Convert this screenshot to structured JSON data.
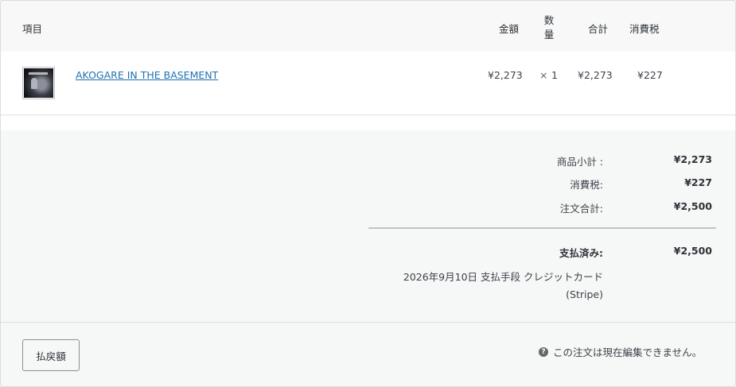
{
  "table": {
    "headers": {
      "item": "項目",
      "cost": "金額",
      "qty_line1": "数",
      "qty_line2": "量",
      "total": "合計",
      "tax": "消費税"
    },
    "row": {
      "name": "AKOGARE IN THE BASEMENT",
      "cost": "¥2,273",
      "times": "×",
      "qty": "1",
      "total": "¥2,273",
      "tax": "¥227"
    }
  },
  "totals": {
    "subtotal_label": "商品小計 :",
    "subtotal_value": "¥2,273",
    "tax_label": "消費税:",
    "tax_value": "¥227",
    "order_total_label": "注文合計:",
    "order_total_value": "¥2,500",
    "paid_label": "支払済み:",
    "paid_value": "¥2,500",
    "payment_info": "2026年9月10日 支払手段 クレジットカード",
    "payment_gateway": "(Stripe)"
  },
  "footer": {
    "refund_label": "払戻額",
    "notice_text": "この注文は現在編集できません。",
    "help_glyph": "?"
  }
}
